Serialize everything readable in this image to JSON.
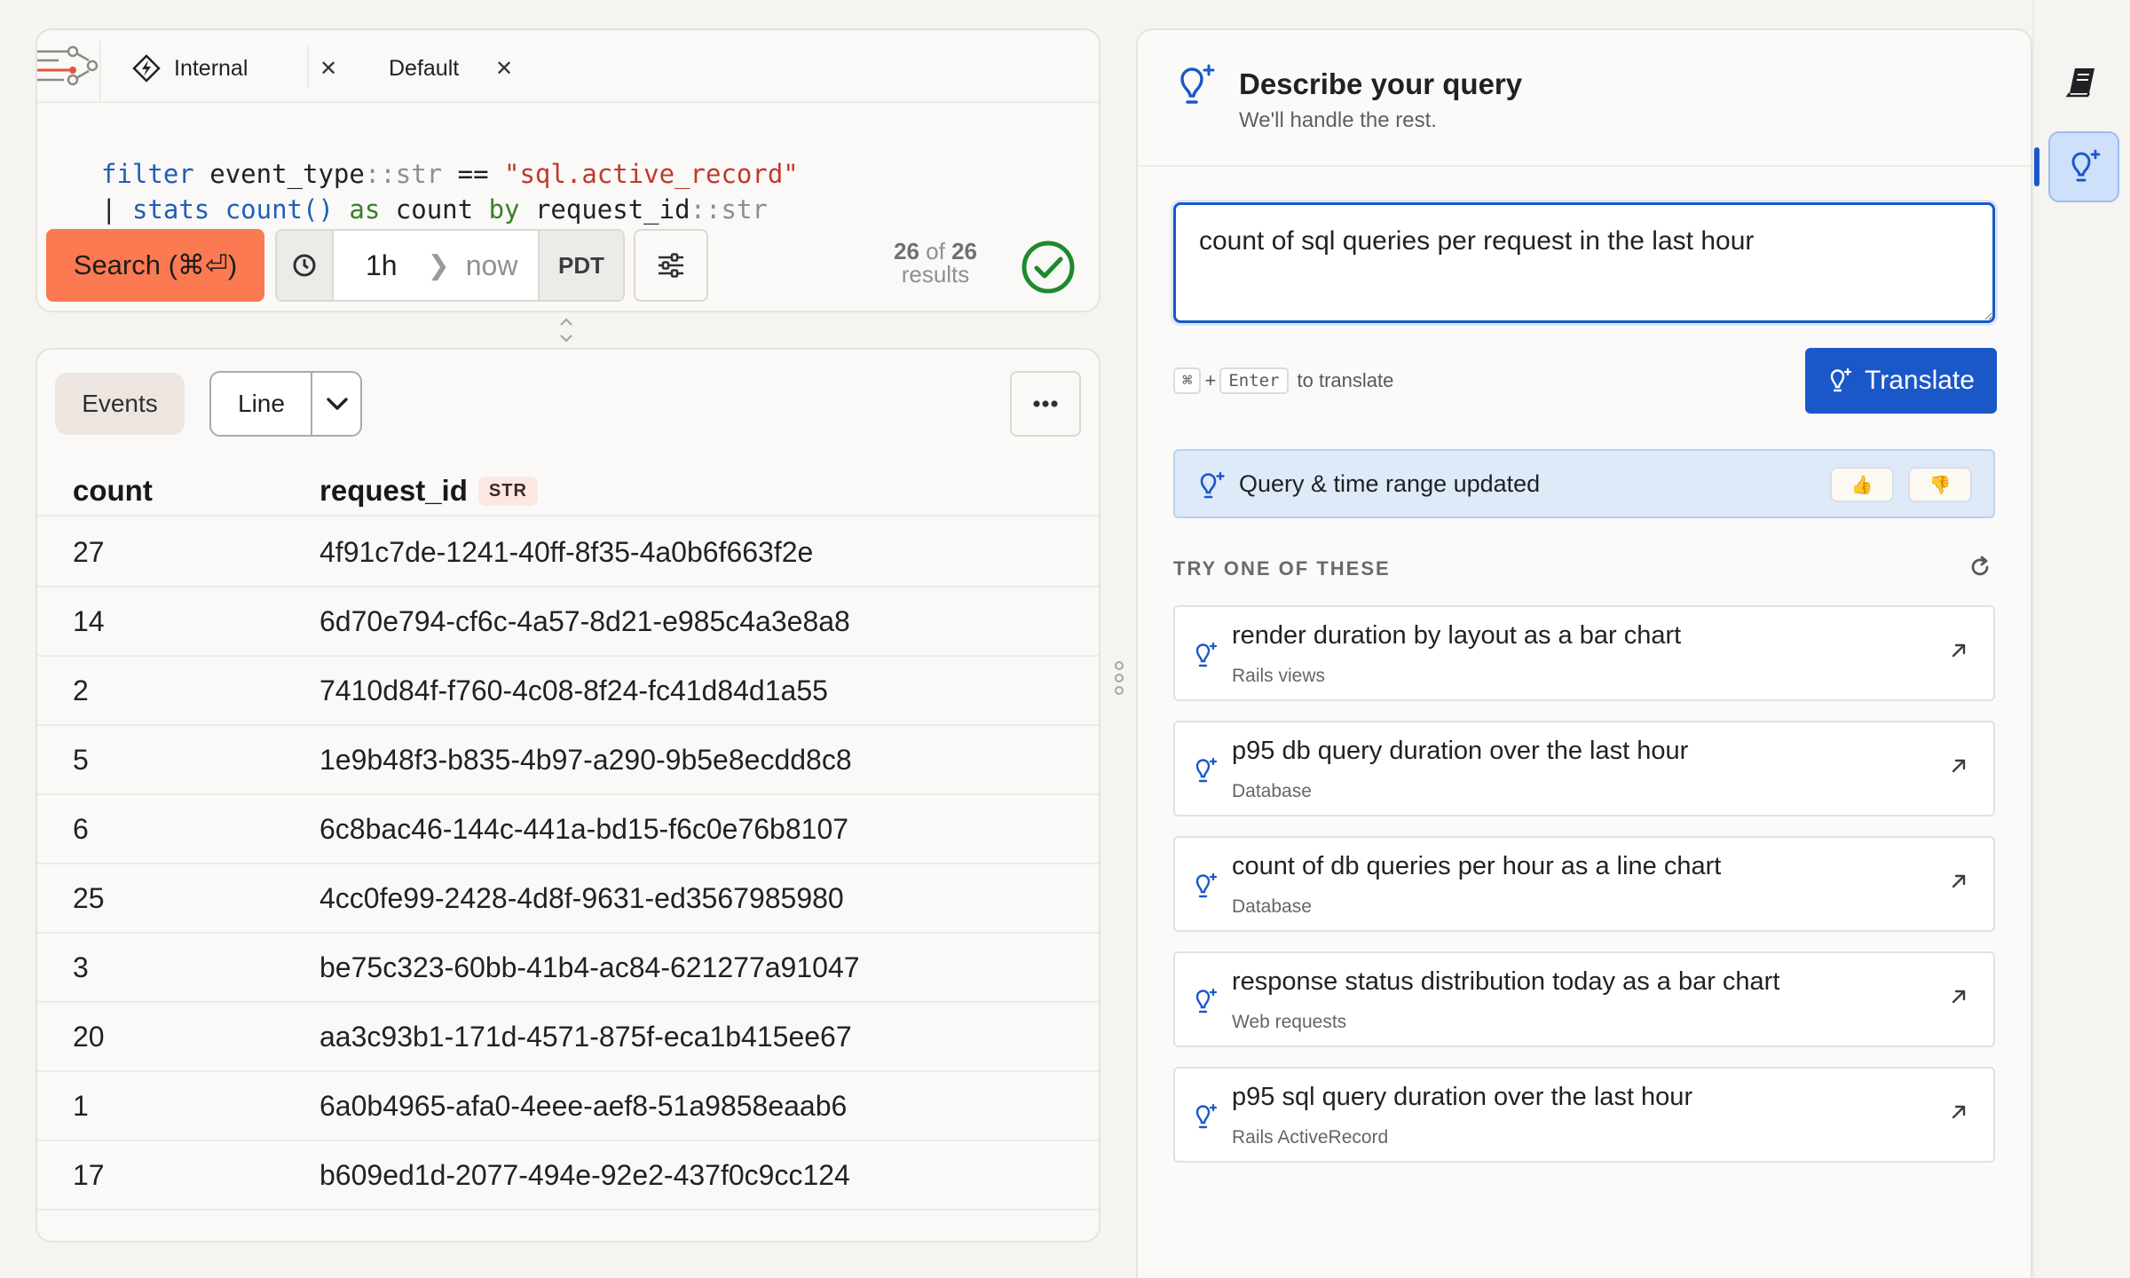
{
  "tabs": [
    {
      "label": "Internal"
    },
    {
      "label": "Default"
    }
  ],
  "query": {
    "line1": {
      "kw": "filter",
      "field": "event_type",
      "type": "::str",
      "op": "==",
      "value": "\"sql.active_record\""
    },
    "line2": {
      "pipe": "|",
      "kw": "stats",
      "fn": "count()",
      "as": "as",
      "alias": "count",
      "by": "by",
      "field": "request_id",
      "type": "::str"
    }
  },
  "toolbar": {
    "search_label": "Search (⌘⏎)",
    "time_from": "1h",
    "time_to": "now",
    "timezone": "PDT",
    "results_shown": "26",
    "results_of": "of",
    "results_total": "26",
    "results_label": "results"
  },
  "results": {
    "events_label": "Events",
    "viz_type": "Line",
    "columns": [
      {
        "name": "count"
      },
      {
        "name": "request_id",
        "type_badge": "STR"
      }
    ],
    "rows": [
      {
        "count": "27",
        "request_id": "4f91c7de-1241-40ff-8f35-4a0b6f663f2e"
      },
      {
        "count": "14",
        "request_id": "6d70e794-cf6c-4a57-8d21-e985c4a3e8a8"
      },
      {
        "count": "2",
        "request_id": "7410d84f-f760-4c08-8f24-fc41d84d1a55"
      },
      {
        "count": "5",
        "request_id": "1e9b48f3-b835-4b97-a290-9b5e8ecdd8c8"
      },
      {
        "count": "6",
        "request_id": "6c8bac46-144c-441a-bd15-f6c0e76b8107"
      },
      {
        "count": "25",
        "request_id": "4cc0fe99-2428-4d8f-9631-ed3567985980"
      },
      {
        "count": "3",
        "request_id": "be75c323-60bb-41b4-ac84-621277a91047"
      },
      {
        "count": "20",
        "request_id": "aa3c93b1-171d-4571-875f-eca1b415ee67"
      },
      {
        "count": "1",
        "request_id": "6a0b4965-afa0-4eee-aef8-51a9858eaab6"
      },
      {
        "count": "17",
        "request_id": "b609ed1d-2077-494e-92e2-437f0c9cc124"
      }
    ]
  },
  "nl": {
    "title": "Describe your query",
    "subtitle": "We'll handle the rest.",
    "input_value": "count of sql queries per request in the last hour",
    "hint_key1": "⌘",
    "hint_plus": "+",
    "hint_key2": "Enter",
    "hint_text": "to translate",
    "translate_label": "Translate",
    "status_text": "Query & time range updated",
    "thumbs_up": "👍",
    "thumbs_down": "👎",
    "suggestions_heading": "TRY ONE OF THESE",
    "suggestions": [
      {
        "title": "render duration by layout as a bar chart",
        "source": "Rails views"
      },
      {
        "title": "p95 db query duration over the last hour",
        "source": "Database"
      },
      {
        "title": "count of db queries per hour as a line chart",
        "source": "Database"
      },
      {
        "title": "response status distribution today as a bar chart",
        "source": "Web requests"
      },
      {
        "title": "p95 sql query duration over the last hour",
        "source": "Rails ActiveRecord"
      }
    ]
  },
  "colors": {
    "search_button": "#fb7a52",
    "primary_blue": "#1a58c9",
    "success_green": "#1e8a2e"
  },
  "icons": {
    "source": "dataset-flow-icon",
    "environment": "lightning-bolt-icon",
    "close": "close-icon",
    "clock": "clock-icon",
    "settings": "sliders-icon",
    "success": "check-circle-icon",
    "more": "ellipsis-icon",
    "query_assistant": "lightbulb-sparkle-icon",
    "refresh": "refresh-icon",
    "open": "arrow-up-right-icon",
    "docs": "book-icon"
  }
}
